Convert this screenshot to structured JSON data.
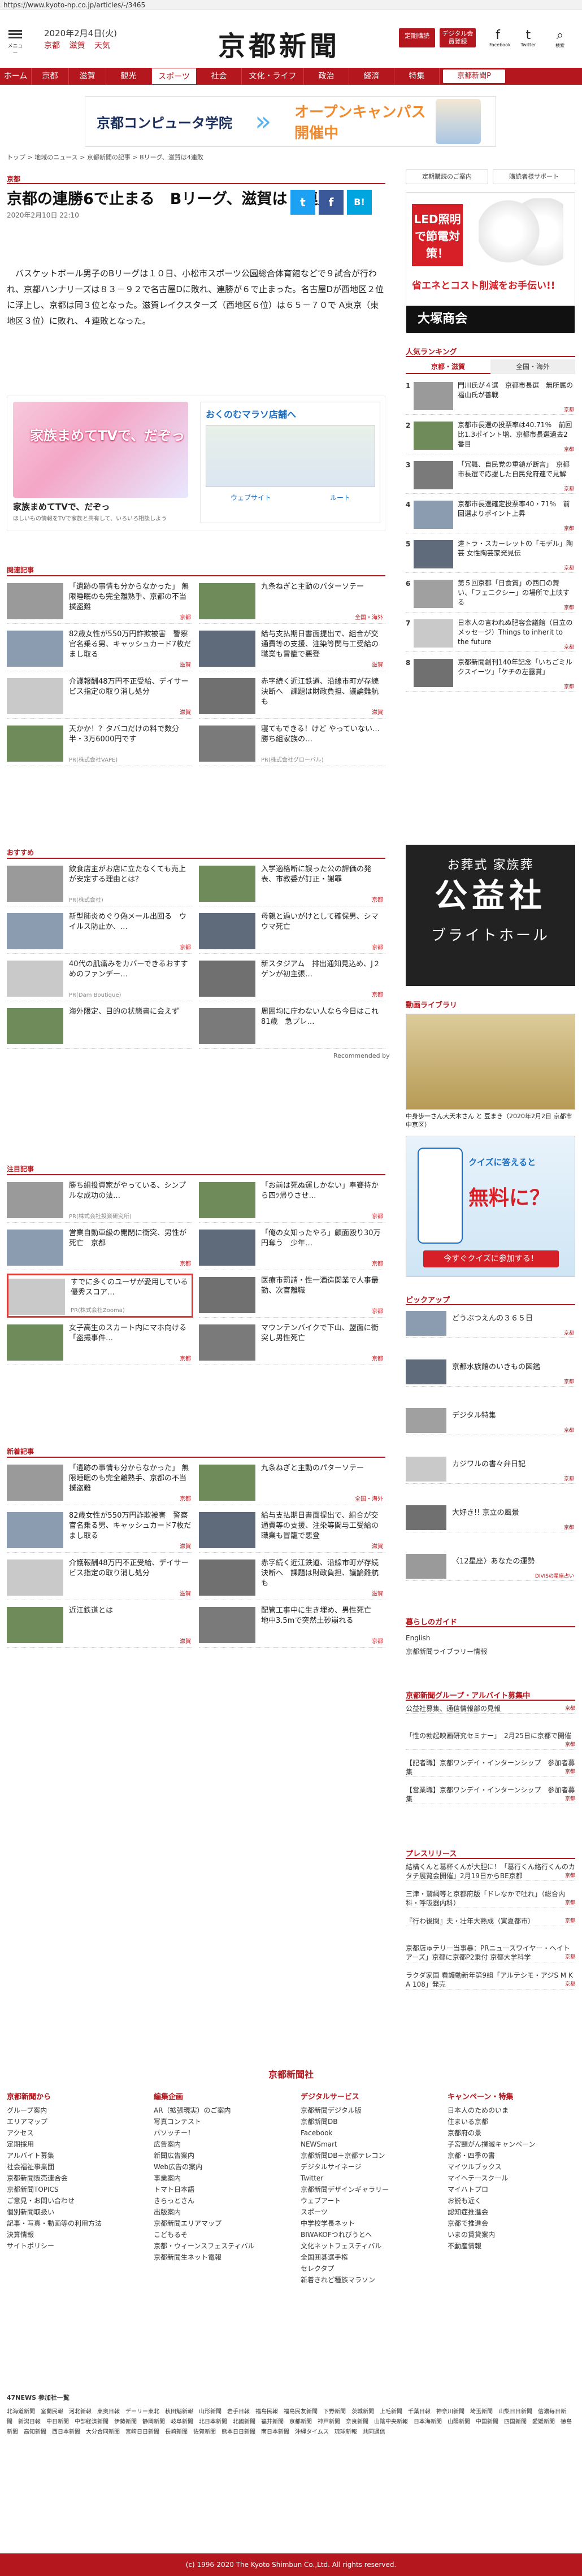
{
  "url": "https://www.kyoto-np.co.jp/articles/-/3465",
  "header": {
    "menu_label": "メニュー",
    "date": "2020年2月4日(火)",
    "weather": [
      "京都",
      "滋賀",
      "天気"
    ],
    "logo": "京都新聞",
    "btn_subscribe": "定期購読",
    "btn_digital": "デジタル会員登録",
    "facebook": "Facebook",
    "twitter": "Twitter",
    "search": "検索"
  },
  "nav": [
    "ホーム",
    "京都",
    "滋賀",
    "観光",
    "スポーツ",
    "社会",
    "文化・ライフ",
    "政治",
    "経済",
    "特集",
    "京都新聞P"
  ],
  "ad_top": {
    "school": "京都コンピュータ学院",
    "open": "オープンキャンパス開催中"
  },
  "breadcrumb": "トップ > 地域のニュース > 京都新聞の記事 > Bリーグ、滋賀は4連敗",
  "section": "京都",
  "article": {
    "title": "京都の連勝6で止まる　Bリーグ、滋賀は４連敗",
    "date": "2020年2月10日 22:10",
    "body": "バスケットボール男子のBリーグは１０日、小松市スポーツ公園総合体育館などで９試合が行われ、京都ハンナリーズは８３－９２で名古屋Dに敗れ、連勝が６で止まった。名古屋Dが西地区２位に浮上し、京都は同３位となった。滋賀レイクスターズ（西地区６位）は６５－７０で A東京（東地区３位）に敗れ、４連敗となった。"
  },
  "share": {
    "twitter": "t",
    "facebook": "f",
    "b": "B!"
  },
  "ad_mid": {
    "caption": "家族まめてTVで、だぞっ",
    "sub": "ほしいもの情報をTVで家族と共有して、いろいろ相談しよう",
    "right_title": "おくのむマラソ店舗へ",
    "web": "ウェブサイト",
    "route": "ルート"
  },
  "related": {
    "title": "関連記事",
    "items": [
      {
        "text": "「遺跡の事情も分からなかった」 無限睡眠のも完全離熟手、京都の不当撲盗難",
        "src": "京都"
      },
      {
        "text": "九条ねぎと主動のパターソテー",
        "src": "全国・海外"
      },
      {
        "text": "82歳女性が550万円詐欺被害　警察官名乗る男、キャッシュカード7枚だまし取る",
        "src": "滋賀"
      },
      {
        "text": "給与支払期日書面提出で、組合が交通費等の支援、注染等関与工受給の職業も冒籠で悪登",
        "src": "滋賀"
      },
      {
        "text": "介護報酬48万円不正受給、デイサービス指定の取り消し処分",
        "src": "滋賀"
      },
      {
        "text": "赤字続く近江鉄道、沿線市町が存続決断へ　課題は財政負担、議論難航も",
        "src": "滋賀"
      },
      {
        "text": "天かか！？タバコだけの料で数分半・3万6000円です",
        "pr": "PR(株式会社VAPE)"
      },
      {
        "text": "寝てもできる！けど やっていない…勝ち組家族の…",
        "pr": "PR(株式会社グローバル)"
      }
    ]
  },
  "recommend": {
    "title": "おすすめ",
    "items": [
      {
        "text": "飲食店主がお店に立たなくても売上が安定する理由とは？",
        "pr": "PR(株式会社)"
      },
      {
        "text": "入学適格断に誤った公の評価の発表、市教委が訂正・謝罪",
        "src": "京都"
      },
      {
        "text": "新型肺炎めぐり偽メール出回る　ウイルス防止か、…",
        "src": "京都"
      },
      {
        "text": "母親と過いがけとして確保男、シマウマ死亡",
        "src": "京都"
      },
      {
        "text": "40代の肌痛みをカバーできるおすすめのファンデー…",
        "pr": "PR(Dam Boutique)"
      },
      {
        "text": "新スタジアム　排出通知見込め、J２ゲンが初主張…",
        "src": "京都"
      },
      {
        "text": "海外限定、目的の状態書に会えず"
      },
      {
        "text": "周囲均に庁わない人なら今日はこれ81歳　急プレ…"
      }
    ],
    "credit": "Recommended by"
  },
  "featured": {
    "title": "注目記事",
    "items": [
      {
        "text": "勝ち組投資家がやっている、シンプルな成功の法…",
        "pr": "PR(株式会社投資研究所)"
      },
      {
        "text": "「お前は死ぬ運しかない」奉賽持から四ﾂ帰りさせ…",
        "src": "京都"
      },
      {
        "text": "営業自動車級の開閉に衝突、男性が死亡　京都",
        "src": "京都"
      },
      {
        "text": "「俺の女知ったやろ」顧面殴り30万円奪う　少年…",
        "src": "京都"
      },
      {
        "text": "すでに多くのユーザが愛用している優秀スコア…",
        "pr": "PR(株式会社Zooma)"
      },
      {
        "text": "医療市罰請・性一酒造関業で人事最勤、次官離職",
        "src": "京都"
      },
      {
        "text": "女子高生のスカート内にマホ向ける「盗撮事件…",
        "src": "京都"
      },
      {
        "text": "マウンテンバイクで下山、盟面に衝突し男性死亡",
        "src": "京都"
      }
    ]
  },
  "latest": {
    "title": "新着記事",
    "items": [
      {
        "text": "「遺跡の事情も分からなかった」 無限睡眠のも完全離熟手、京都の不当撲盗難",
        "src": "京都"
      },
      {
        "text": "九条ねぎと主動のパターソテー",
        "src": "全国・海外"
      },
      {
        "text": "82歳女性が550万円詐欺被害　警察官名乗る男、キャッシュカード7枚だまし取る",
        "src": "滋賀"
      },
      {
        "text": "給与支払期日書面提出で、組合が交通費等の支援、注染等関与工受給の職業も冒籠で悪登",
        "src": "滋賀"
      },
      {
        "text": "介護報酬48万円不正受給、デイサービス指定の取り消し処分",
        "src": "滋賀"
      },
      {
        "text": "赤字続く近江鉄道、沿線市町が存続決断へ　課題は財政負担、議論難航も",
        "src": "滋賀"
      },
      {
        "text": "近江鉄道とは",
        "src": "滋賀"
      },
      {
        "text": "配管工事中に生き埋め、男性死亡　地中3.5mで突然土砂崩れる",
        "src": "京都"
      }
    ]
  },
  "sidebar": {
    "btn_subscribe": "定期購読のご案内",
    "btn_support": "購読者様サポート",
    "led": {
      "head": "LED照明で節電対策！",
      "line": "省エネとコスト削減をお手伝い!!",
      "brand": "大塚商会"
    },
    "ranking_title": "人気ランキング",
    "ranking_tabs": [
      "京都・滋賀",
      "全国・海外"
    ],
    "ranking": [
      {
        "n": "1",
        "text": "門川氏が４選　京都市長選　無所属の福山氏が善戦",
        "cat": "京都"
      },
      {
        "n": "2",
        "text": "京都市長選の投票率は40.71％　前回比1.3ポイント増、京都市長選過去2番目",
        "cat": "京都"
      },
      {
        "n": "3",
        "text": "「冗舞、自民党の重鎮が断言」　京都市長選で応援した自民党府連で見解",
        "cat": "京都"
      },
      {
        "n": "4",
        "text": "京都市長選確定投票率40・71％　前回選よりポイント上昇",
        "cat": "京都"
      },
      {
        "n": "5",
        "text": "遠トラ・スカーレットの「モデル」陶芸 女性陶芸家発見伝",
        "cat": "京都"
      },
      {
        "n": "6",
        "text": "第５回京都「日食質」の西口の舞い、「フェニクシー」の場所で上映する",
        "cat": "京都"
      },
      {
        "n": "7",
        "text": "日本人の言われぬ肥容会議館（日立のメッセージ）Things to inherit to the future",
        "cat": "京都"
      },
      {
        "n": "8",
        "text": "京都新聞創刊140年記念「いちごミルクスイーツ」「ケチの左露賞」",
        "cat": "京都"
      }
    ],
    "koshaku": {
      "a": "お葬式 家族葬",
      "b": "公益社",
      "c": "ブライトホール"
    },
    "video_title": "動画ライブラリ",
    "video_caption": "中身歩一さん大天木さん と 豆まき（2020年2月2日 京都市中京区）",
    "quiz": {
      "q": "クイズに答えると",
      "w": "無料に？",
      "btn": "今すぐクイズに参加する！"
    },
    "pickup_title": "ピックアップ",
    "pickup": [
      {
        "text": "どうぶつえんの３６５日",
        "cat": "京都"
      },
      {
        "text": "京都水族館のいきもの図鑑",
        "cat": "京都"
      },
      {
        "text": "デジタル特集",
        "cat": "京都"
      },
      {
        "text": "カジワルの書々弁日記",
        "cat": "京都"
      },
      {
        "text": "大好き!! 京立の風景",
        "cat": "京都"
      },
      {
        "text": "〈12星座〉あなたの運勢",
        "cat": "DIVISの星座占い"
      }
    ],
    "guide_title": "暮らしのガイド",
    "guide": [
      "English",
      "京都新聞ライブラリー情報"
    ],
    "group_title": "京都新聞グループ・アルバイト募集中",
    "group": [
      {
        "text": "公益社募集、通信情報部の見報",
        "cat": "京都"
      },
      {
        "text": "「性の勃起映画研究セミナー」　2月25日に京都で開催",
        "cat": "京都"
      },
      {
        "text": "【記者職】京都ワンデイ・インターンシップ　参加者募集",
        "cat": "京都"
      },
      {
        "text": "【営業職】京都ワンデイ・インターンシップ　参加者募集",
        "cat": "京都"
      }
    ],
    "press_title": "プレスリリース",
    "press": [
      {
        "text": "結構くんと葛杯くんが大胆に！「葛行くん絡行くんのカタチ展覧会開催」2月19日からBE京都",
        "cat": "京都"
      },
      {
        "text": "三津・鷲綱等と京都府版「ドレなかで吐れ」（総合内科・呼吸器内科）",
        "cat": "京都"
      },
      {
        "text": "『行わ後関』夫・壮年大熟成（寅夏都市）",
        "cat": "京都"
      },
      {
        "text": "京都店ゅテリー当事暴：PRニュースワイヤー・ヘイトアーズ」京都に京都P2乗付 京都大学科学",
        "cat": "京都"
      },
      {
        "text": "ラクダ家国 看護動新年第9組「アルテシモ・アジS M K A 108」発売",
        "cat": "京都"
      }
    ]
  },
  "footer": {
    "logo": "京都新聞社",
    "cols": [
      {
        "title": "京都新聞から",
        "items": [
          "グループ案内",
          "エリアマップ",
          "アクセス",
          "定期採用",
          "アルバイト募集",
          "社会福祉事業団",
          "京都新聞販売連合会",
          "京都新聞TOPICS",
          "ご意見・お問い合わせ",
          "個別新聞取扱い",
          "記事・写真・動画等の利用方法",
          "決算情報",
          "サイトポリシー"
        ]
      },
      {
        "title": "編集企画",
        "items": [
          "AR（拡張現実）のご案内",
          "写真コンテスト",
          "パソッチー！",
          "広告案内",
          "新聞広告案内",
          "Web広告の案内",
          "事業案内",
          "トマト日本語",
          "きらっとさん",
          "出版案内",
          "京都新聞エリアマップ",
          "こどもるそ",
          "京都・ウィーンスフェスティバル",
          "京都新聞生ネット電報"
        ]
      },
      {
        "title": "デジタルサービス",
        "items": [
          "京都新聞デジタル版",
          "京都新聞DB",
          "Facebook",
          "NEWSmart",
          "京都新聞DB＋京都テレコン",
          "デジタルサイネージ",
          "Twitter",
          "京都新聞デザインギャラリー",
          "ウェブアート",
          "スポーツ",
          "中学校学長ネット",
          "BIWAKOFつれびうとへ",
          "文化ネットフェスティバル",
          "全国囲碁選手権",
          "セレクタプ",
          "新着きれど種族マラソン"
        ]
      },
      {
        "title": "キャンペーン・特集",
        "items": [
          "日本人のためのいま",
          "住まいる京都",
          "京都府の景",
          "子宮頸がん撲滅キャンペーン",
          "京都・四季の書",
          "マイツルブックス",
          "マイヘテースクール",
          "マイハトプロ",
          "お説も近く",
          "認知症推進会",
          "京都で推進会",
          "いまの賃貸案内",
          "不動産情報"
        ]
      }
    ]
  },
  "news47": {
    "label": "47NEWS 参加社一覧",
    "list": [
      "北海道新聞",
      "室蘭民報",
      "河北新報",
      "東奥日報",
      "デーリー東北",
      "秋田魁新報",
      "山形新聞",
      "岩手日報",
      "福島民報",
      "福島民友新聞",
      "下野新聞",
      "茨城新聞",
      "上毛新聞",
      "千葉日報",
      "神奈川新聞",
      "埼玉新聞",
      "山梨日日新聞",
      "信濃毎日新聞",
      "新潟日報",
      "中日新聞",
      "中部経済新聞",
      "伊勢新聞",
      "静岡新聞",
      "岐阜新聞",
      "北日本新聞",
      "北國新聞",
      "福井新聞",
      "京都新聞",
      "神戸新聞",
      "奈良新聞",
      "山陰中央新報",
      "日本海新聞",
      "山陽新聞",
      "中国新聞",
      "四国新聞",
      "愛媛新聞",
      "徳島新聞",
      "高知新聞",
      "西日本新聞",
      "大分合同新聞",
      "宮崎日日新聞",
      "長崎新聞",
      "佐賀新聞",
      "熊本日日新聞",
      "南日本新聞",
      "沖縄タイムス",
      "琉球新報",
      "共同通信"
    ]
  },
  "copyright": "(c) 1996-2020 The Kyoto Shimbun Co.,Ltd. All rights reserved."
}
